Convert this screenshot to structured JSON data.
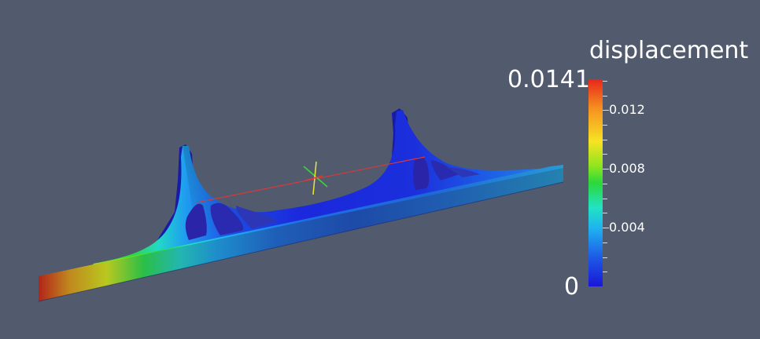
{
  "app": {
    "background_color": "#525a6d"
  },
  "colorbar": {
    "title": "displacement",
    "max_label": "0.0141",
    "min_label": "0",
    "min_value": 0,
    "max_value": 0.0141,
    "ticks": [
      {
        "value": 0.004,
        "label": "0.004"
      },
      {
        "value": 0.008,
        "label": "0.008"
      },
      {
        "value": 0.012,
        "label": "0.012"
      }
    ],
    "colormap": [
      "#1a16d8",
      "#1d5ae6",
      "#1fb2f0",
      "#22e3c4",
      "#2bd83a",
      "#8ee51f",
      "#f7e323",
      "#f59020",
      "#e8261a"
    ]
  },
  "scene": {
    "object": "bracket-beam",
    "axes_widget_colors": [
      "#d83a3a",
      "#3ad83a",
      "#e8e83a"
    ]
  }
}
